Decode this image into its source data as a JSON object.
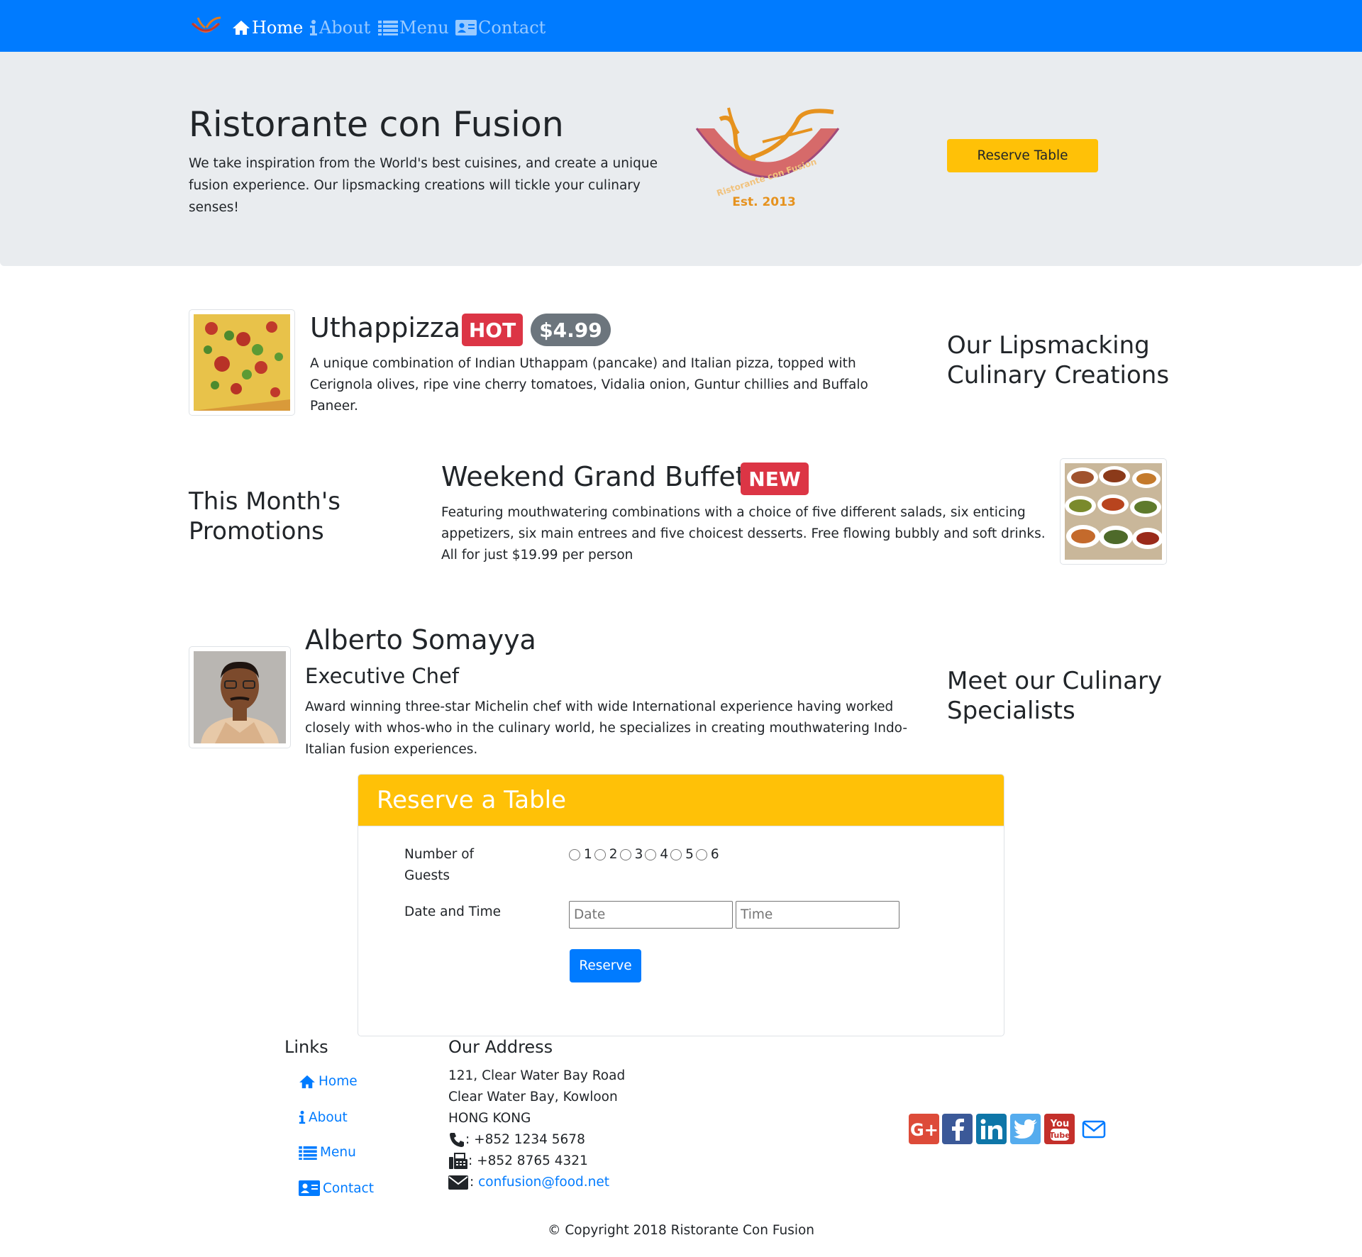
{
  "nav": {
    "items": [
      {
        "label": "Home",
        "active": true
      },
      {
        "label": "About",
        "active": false
      },
      {
        "label": "Menu",
        "active": false
      },
      {
        "label": "Contact",
        "active": false
      }
    ]
  },
  "jumbotron": {
    "title": "Ristorante con Fusion",
    "description": "We take inspiration from the World's best cuisines, and create a unique fusion experience. Our lipsmacking creations will tickle your culinary senses!",
    "logo_text": "Ristorante con Fusion",
    "logo_est": "Est. 2013",
    "reserve_button": "Reserve Table"
  },
  "dish": {
    "name": "Uthappizza",
    "badge": "HOT",
    "price": "$4.99",
    "description": "A unique combination of Indian Uthappam (pancake) and Italian pizza, topped with Cerignola olives, ripe vine cherry tomatoes, Vidalia onion, Guntur chillies and Buffalo Paneer.",
    "side_title": "Our Lipsmacking Culinary Creations"
  },
  "promotion": {
    "side_title": "This Month's Promotions",
    "name": "Weekend Grand Buffet",
    "badge": "NEW",
    "description": "Featuring mouthwatering combinations with a choice of five different salads, six enticing appetizers, six main entrees and five choicest desserts. Free flowing bubbly and soft drinks. All for just $19.99 per person"
  },
  "leader": {
    "name": "Alberto Somayya",
    "designation": "Executive Chef",
    "description": "Award winning three-star Michelin chef with wide International experience having worked closely with whos-who in the culinary world, he specializes in creating mouthwatering Indo-Italian fusion experiences.",
    "side_title": "Meet our Culinary Specialists"
  },
  "reservation": {
    "title": "Reserve a Table",
    "guests_label": "Number of Guests",
    "guest_options": [
      "1",
      "2",
      "3",
      "4",
      "5",
      "6"
    ],
    "datetime_label": "Date and Time",
    "date_placeholder": "Date",
    "time_placeholder": "Time",
    "submit": "Reserve"
  },
  "footer": {
    "links_heading": "Links",
    "links": [
      "Home",
      "About",
      "Menu",
      "Contact"
    ],
    "address_heading": "Our Address",
    "address": [
      "121, Clear Water Bay Road",
      "Clear Water Bay, Kowloon",
      "HONG KONG"
    ],
    "phone": ": +852 1234 5678",
    "fax": ": +852 8765 4321",
    "email": "confusion@food.net",
    "social": [
      "google-plus",
      "facebook",
      "linkedin",
      "twitter",
      "youtube",
      "mail"
    ],
    "copyright": "© Copyright 2018 Ristorante Con Fusion"
  },
  "colors": {
    "primary": "#007bff",
    "warning": "#ffc107",
    "danger": "#dc3545",
    "secondary": "#6c757d",
    "jumbotron_bg": "#e9ecef"
  }
}
